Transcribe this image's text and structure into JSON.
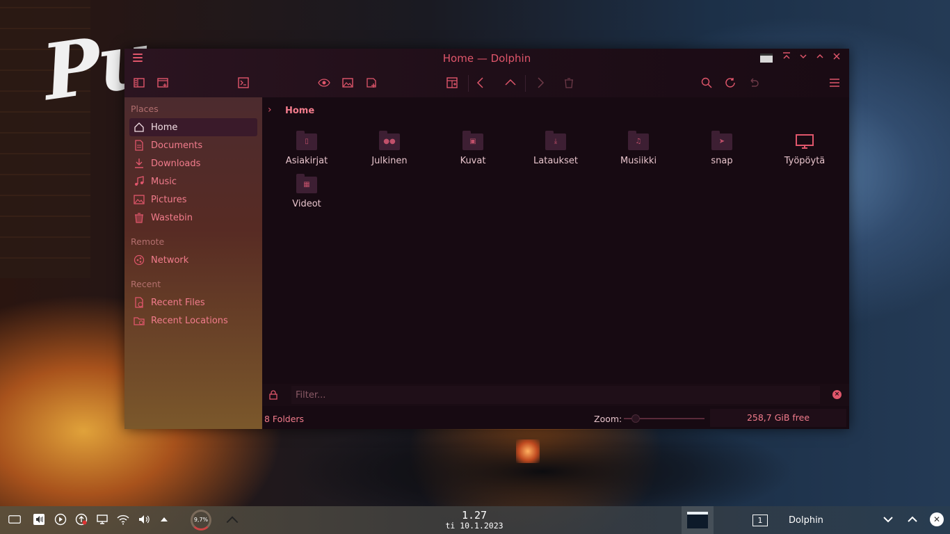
{
  "window": {
    "title": "Home — Dolphin"
  },
  "sidebar": {
    "places_title": "Places",
    "places": [
      {
        "label": "Home",
        "icon": "home-icon"
      },
      {
        "label": "Documents",
        "icon": "document-icon"
      },
      {
        "label": "Downloads",
        "icon": "download-icon"
      },
      {
        "label": "Music",
        "icon": "music-icon"
      },
      {
        "label": "Pictures",
        "icon": "picture-icon"
      },
      {
        "label": "Wastebin",
        "icon": "trash-icon"
      }
    ],
    "remote_title": "Remote",
    "remote": [
      {
        "label": "Network",
        "icon": "network-icon"
      }
    ],
    "recent_title": "Recent",
    "recent": [
      {
        "label": "Recent Files",
        "icon": "recent-files-icon"
      },
      {
        "label": "Recent Locations",
        "icon": "recent-locations-icon"
      }
    ]
  },
  "breadcrumb": {
    "current": "Home"
  },
  "items": [
    {
      "label": "Asiakirjat",
      "icon": "documents-folder-icon"
    },
    {
      "label": "Julkinen",
      "icon": "public-folder-icon"
    },
    {
      "label": "Kuvat",
      "icon": "pictures-folder-icon"
    },
    {
      "label": "Lataukset",
      "icon": "downloads-folder-icon"
    },
    {
      "label": "Musiikki",
      "icon": "music-folder-icon"
    },
    {
      "label": "snap",
      "icon": "snap-folder-icon"
    },
    {
      "label": "Työpöytä",
      "icon": "desktop-icon"
    },
    {
      "label": "Videot",
      "icon": "videos-folder-icon"
    }
  ],
  "filter": {
    "placeholder": "Filter...",
    "value": ""
  },
  "status": {
    "count": "8 Folders",
    "zoom_label": "Zoom:",
    "zoom_level": 0.15,
    "free_space": "258,7 GiB free"
  },
  "taskbar": {
    "cpu": "9,7%",
    "time": "1.27",
    "date": "ti 10.1.2023",
    "pager": "1",
    "task_label": "Dolphin"
  },
  "colors": {
    "accent": "#e0566b",
    "text_light": "#e8c4cc",
    "window_bg": "#170a12",
    "folder": "#3d1f33"
  }
}
